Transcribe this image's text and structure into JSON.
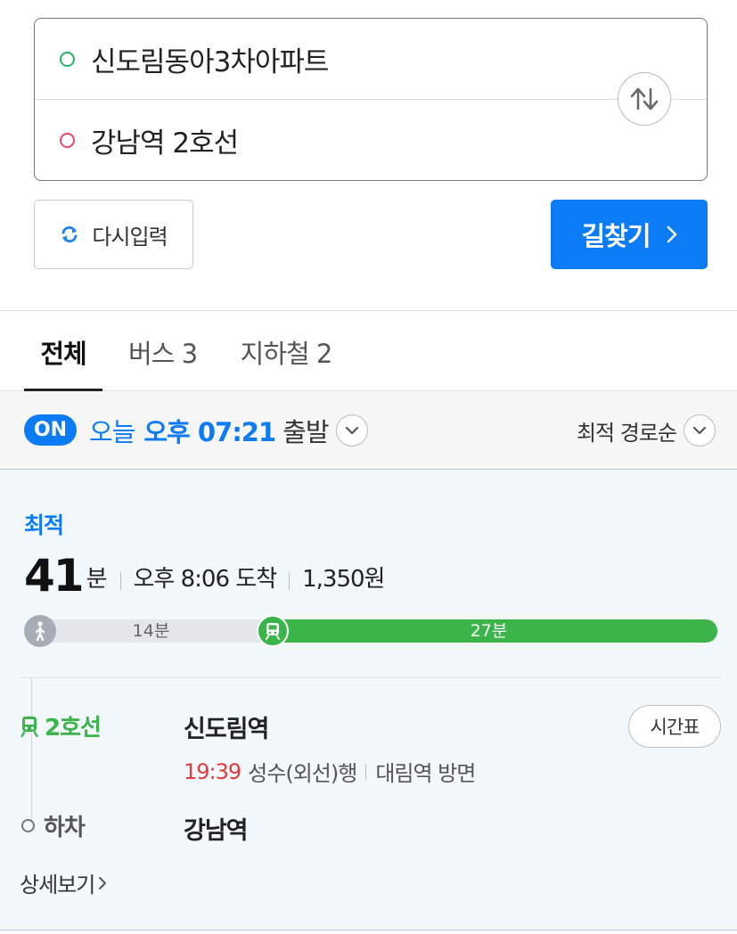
{
  "route": {
    "start": "신도림동아3차아파트",
    "end": "강남역 2호선"
  },
  "buttons": {
    "reset": "다시입력",
    "search": "길찾기"
  },
  "tabs": [
    {
      "label": "전체",
      "active": true
    },
    {
      "label": "버스 3",
      "active": false
    },
    {
      "label": "지하철 2",
      "active": false
    }
  ],
  "filter": {
    "toggle": "ON",
    "day": "오늘",
    "time": "오후 07:21",
    "suffix": "출발",
    "sort": "최적 경로순"
  },
  "result": {
    "badge": "최적",
    "duration": "41",
    "duration_unit": "분",
    "arrival": "오후 8:06 도착",
    "fare": "1,350원",
    "walk_label": "14분",
    "train_label": "27분",
    "walk_fraction": 0.34,
    "line": "2호선",
    "board_station": "신도림역",
    "schedule": "시간표",
    "depart_time": "19:39",
    "direction": "성수(외선)행",
    "heading": "대림역 방면",
    "alight_label": "하차",
    "alight_station": "강남역",
    "detail": "상세보기"
  },
  "colors": {
    "accent": "#0b7cf5",
    "line2": "#3bb54a",
    "start_dot": "#25b26a",
    "end_dot": "#e8466a",
    "time_red": "#e03c3c"
  }
}
